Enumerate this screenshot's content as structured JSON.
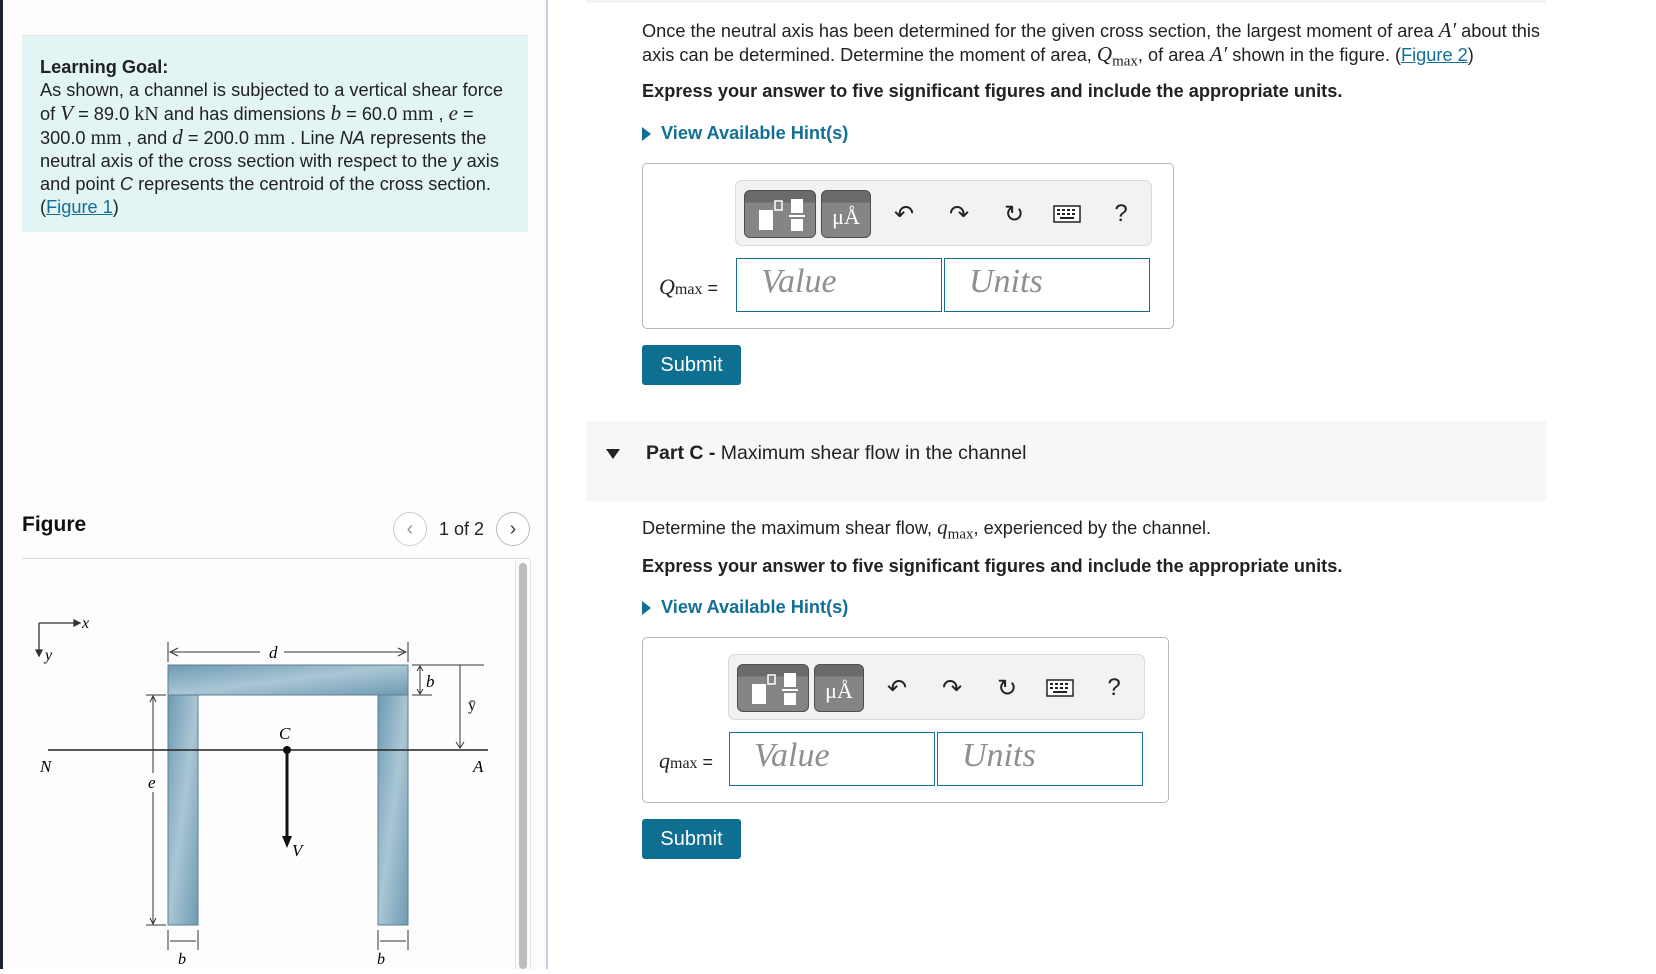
{
  "learning_goal": {
    "title": "Learning Goal:",
    "t1": "As shown, a channel is subjected to a vertical shear force of ",
    "V_sym": "V",
    "t2": " = 89.0 ",
    "V_unit": "kN",
    "t3": " and has dimensions ",
    "b_sym": "b",
    "t4": " = 60.0 ",
    "mm1": "mm",
    "t5": " , ",
    "e_sym": "e",
    "t6": " = 300.0 ",
    "mm2": "mm",
    "t7": " , and ",
    "d_sym": "d",
    "t8": " = 200.0 ",
    "mm3": "mm",
    "t9": " . Line ",
    "na": "NA",
    "t10": " represents the neutral axis of the cross section with respect to the ",
    "y": "y",
    "t11": " axis and point ",
    "c": "C",
    "t12": " represents the centroid of the cross section.",
    "open_paren": "(",
    "figure_link": "Figure 1",
    "close_paren": ")"
  },
  "figure": {
    "title": "Figure",
    "pager": "1 of 2",
    "prev_glyph": "‹",
    "next_glyph": "›",
    "labels": {
      "x": "x",
      "y": "y",
      "d": "d",
      "b": "b",
      "ybar": "ȳ",
      "C": "C",
      "N": "N",
      "A": "A",
      "e": "e",
      "V": "V",
      "b_left": "b",
      "b_right": "b"
    }
  },
  "part_b": {
    "q1": "Once the neutral axis has been determined for the given cross section, the largest moment of area ",
    "A_prime": "A′",
    "q2": " about this axis can be determined. Determine the moment of area, ",
    "Q_sym": "Q",
    "Q_sub": "max",
    "q3": ", of area ",
    "A_prime2": "A′",
    "q4": " shown in the figure. (",
    "figure_link": "Figure 2",
    "q5": ")",
    "instruction": "Express your answer to five significant figures and include the appropriate units.",
    "hint": "View Available Hint(s)",
    "eq_sym": "Q",
    "eq_sub": "max",
    "eq_sign": " =",
    "value_placeholder": "Value",
    "units_placeholder": "Units",
    "submit": "Submit"
  },
  "part_c": {
    "label": "Part C - ",
    "title": "Maximum shear flow in the channel",
    "q1": "Determine the maximum shear flow, ",
    "q_sym": "q",
    "q_sub": "max",
    "q2": ", experienced by the channel.",
    "instruction": "Express your answer to five significant figures and include the appropriate units.",
    "hint": "View Available Hint(s)",
    "eq_sym": "q",
    "eq_sub": "max",
    "eq_sign": " =",
    "value_placeholder": "Value",
    "units_placeholder": "Units",
    "submit": "Submit"
  },
  "toolbar": {
    "templates_icon": "fraction-templates-icon",
    "units_label": "μÅ",
    "undo": "↶",
    "redo": "↷",
    "reset": "↻",
    "help": "?"
  },
  "colors": {
    "accent": "#136f97",
    "submit_bg": "#0e6f91",
    "goal_bg": "#e2f4f4",
    "channel": "#7ba3bb"
  }
}
